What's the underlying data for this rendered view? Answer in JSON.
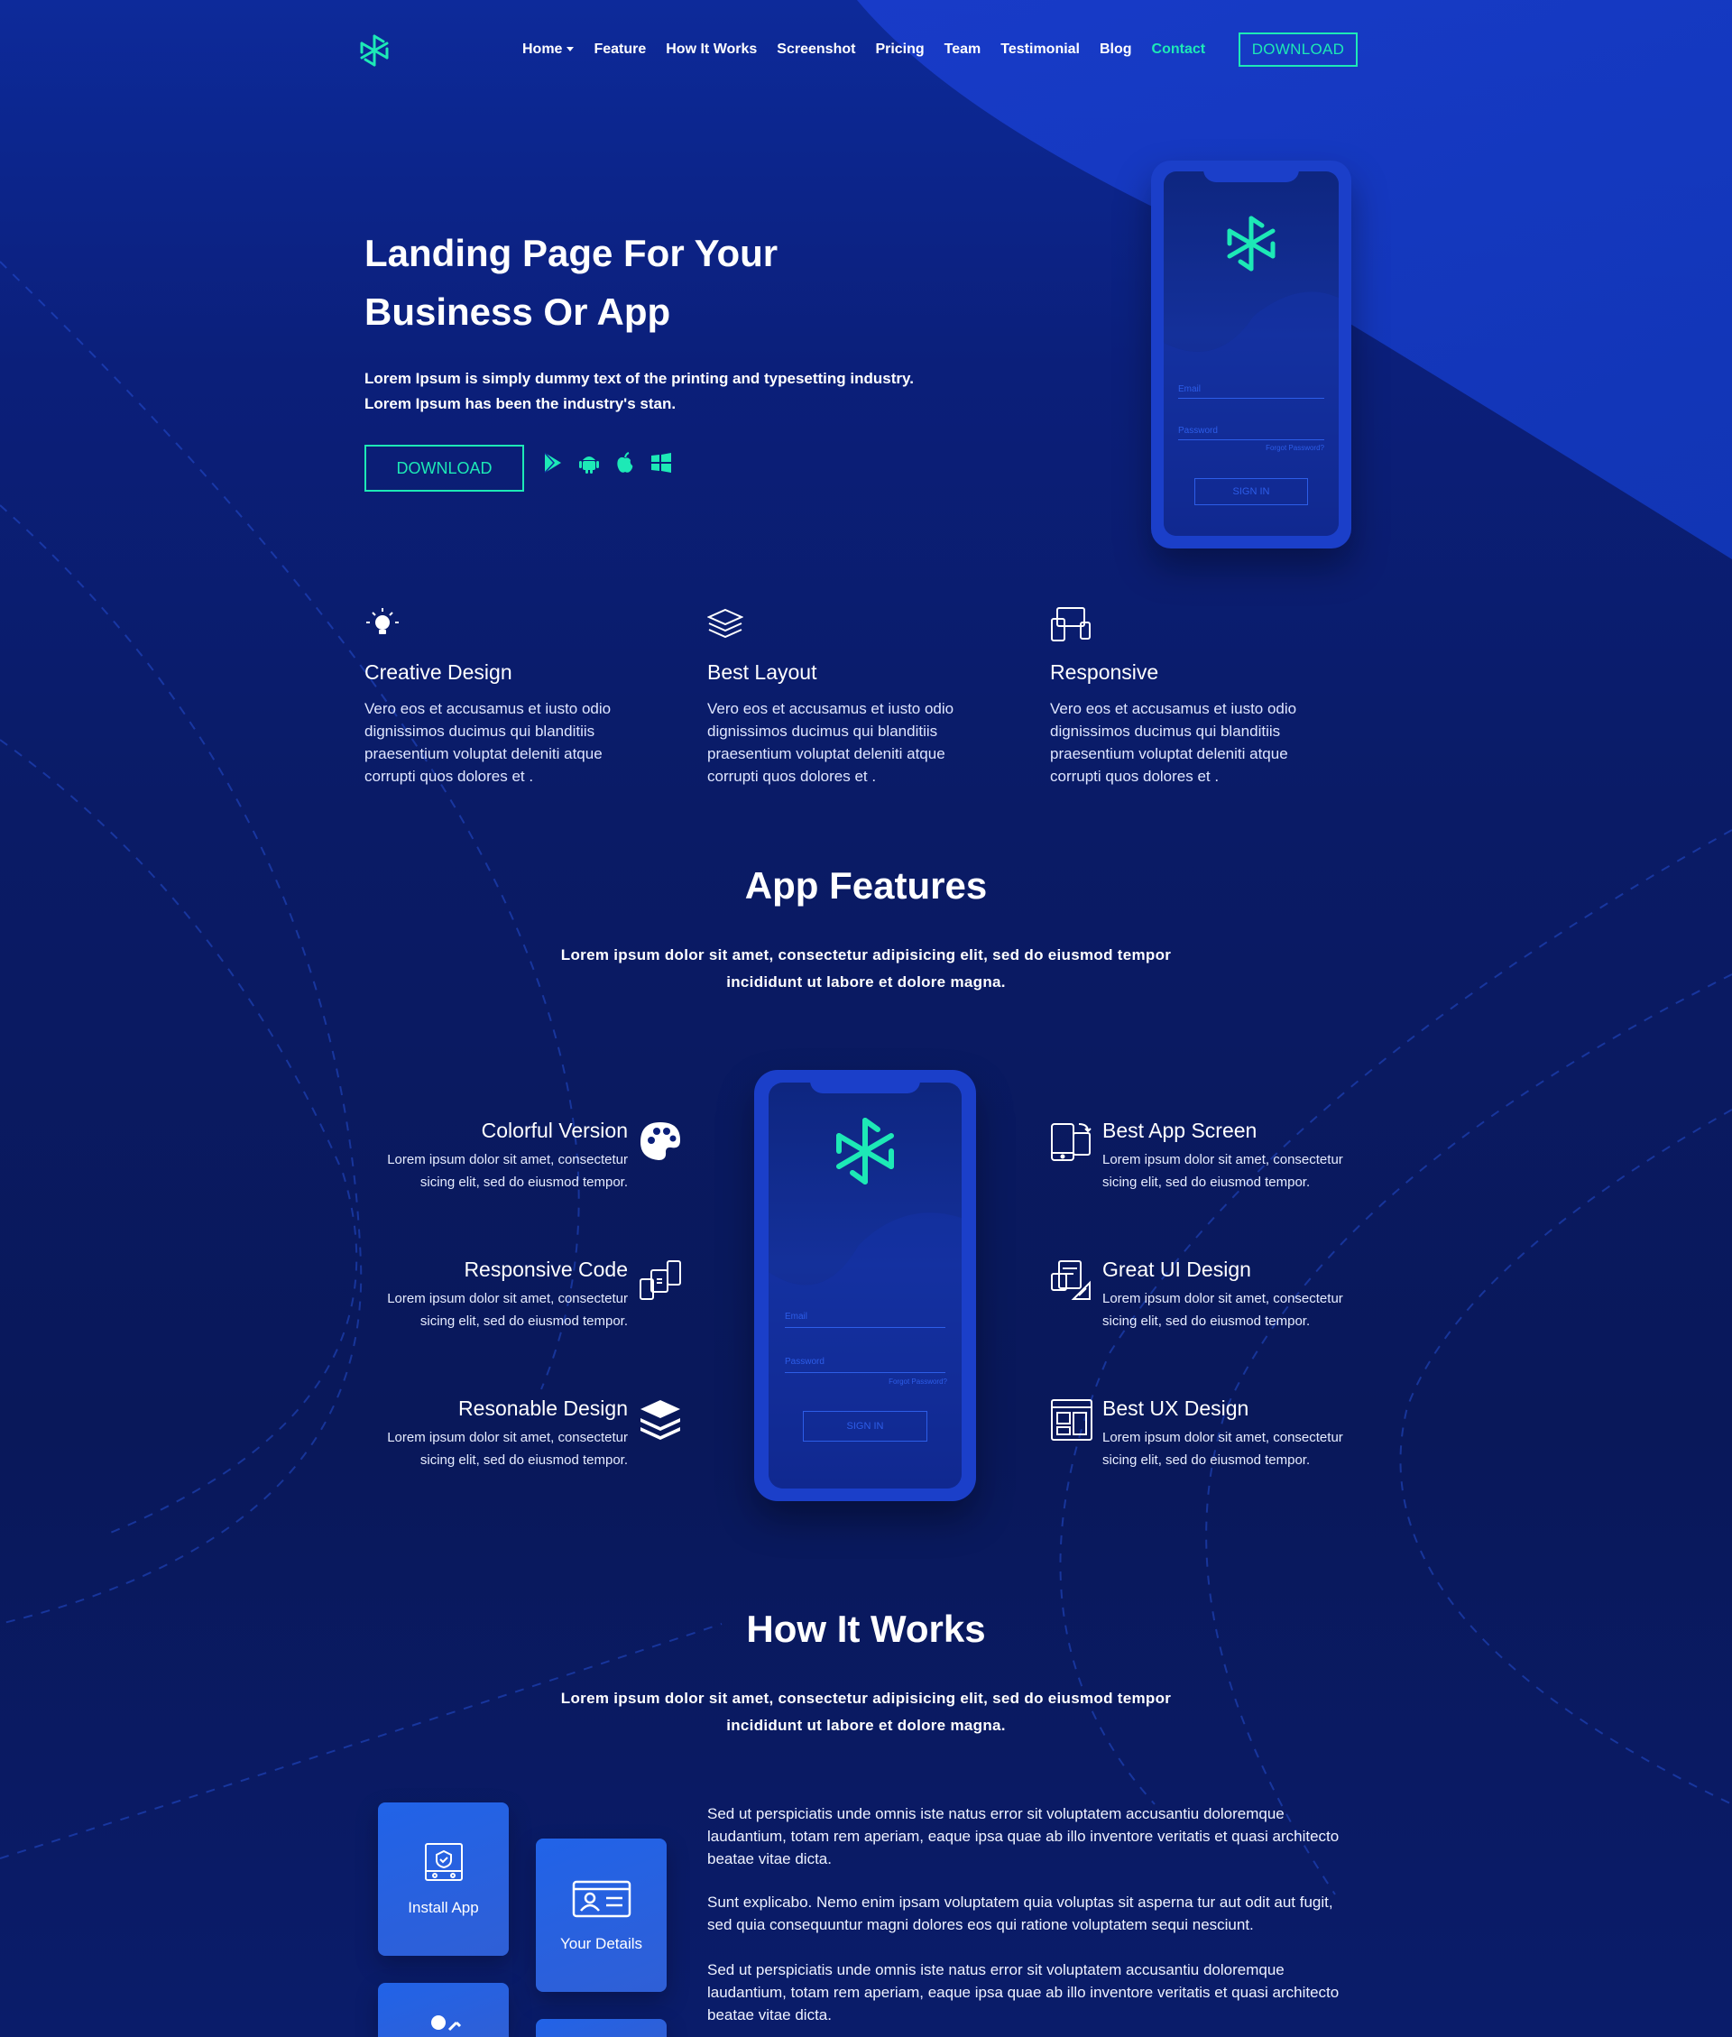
{
  "nav": {
    "items": [
      {
        "label": "Home",
        "active": false,
        "has_dropdown": true
      },
      {
        "label": "Feature",
        "active": false
      },
      {
        "label": "How It Works",
        "active": false
      },
      {
        "label": "Screenshot",
        "active": false
      },
      {
        "label": "Pricing",
        "active": false
      },
      {
        "label": "Team",
        "active": false
      },
      {
        "label": "Testimonial",
        "active": false
      },
      {
        "label": "Blog",
        "active": false
      },
      {
        "label": "Contact",
        "active": true
      }
    ],
    "download_label": "DOWNLOAD"
  },
  "hero": {
    "title_line1": "Landing Page For Your",
    "title_line2": "Business Or App",
    "text_line1": "Lorem Ipsum is simply dummy text of the printing and typesetting industry.",
    "text_line2": "Lorem Ipsum has been the industry's stan.",
    "download_label": "DOWNLOAD",
    "store_icons": [
      "google-play-icon",
      "android-icon",
      "apple-icon",
      "windows-icon"
    ]
  },
  "phone": {
    "email_label": "Email",
    "password_label": "Password",
    "forgot_label": "Forgot Password?",
    "signin_label": "SIGN IN"
  },
  "features": [
    {
      "icon": "lightbulb-icon",
      "title": "Creative Design",
      "text": "Vero eos et accusamus et iusto odio dignissimos ducimus qui blanditiis praesentium voluptat deleniti atque corrupti quos dolores et ."
    },
    {
      "icon": "layers-icon",
      "title": "Best Layout",
      "text": "Vero eos et accusamus et iusto odio dignissimos ducimus qui blanditiis praesentium voluptat deleniti atque corrupti quos dolores et ."
    },
    {
      "icon": "devices-icon",
      "title": "Responsive",
      "text": "Vero eos et accusamus et iusto odio dignissimos ducimus qui blanditiis praesentium voluptat deleniti atque corrupti quos dolores et ."
    }
  ],
  "app_features": {
    "title": "App Features",
    "subtitle_line1": "Lorem ipsum dolor sit amet, consectetur adipisicing elit, sed do eiusmod tempor",
    "subtitle_line2": "incididunt ut labore et dolore magna.",
    "left": [
      {
        "icon": "palette-icon",
        "title": "Colorful Version",
        "line1": "Lorem ipsum dolor sit amet, consectetur",
        "line2": "sicing elit, sed do eiusmod tempor."
      },
      {
        "icon": "responsive-code-icon",
        "title": "Responsive Code",
        "line1": "Lorem ipsum dolor sit amet, consectetur",
        "line2": "sicing elit, sed do eiusmod tempor."
      },
      {
        "icon": "stack-icon",
        "title": "Resonable Design",
        "line1": "Lorem ipsum dolor sit amet, consectetur",
        "line2": "sicing elit, sed do eiusmod tempor."
      }
    ],
    "right": [
      {
        "icon": "app-screen-icon",
        "title": "Best App Screen",
        "line1": "Lorem ipsum dolor sit amet, consectetur",
        "line2": "sicing elit, sed do eiusmod tempor."
      },
      {
        "icon": "ui-design-icon",
        "title": "Great UI Design",
        "line1": "Lorem ipsum dolor sit amet, consectetur",
        "line2": "sicing elit, sed do eiusmod tempor."
      },
      {
        "icon": "ux-design-icon",
        "title": "Best UX Design",
        "line1": "Lorem ipsum dolor sit amet, consectetur",
        "line2": "sicing elit, sed do eiusmod tempor."
      }
    ]
  },
  "how_it_works": {
    "title": "How It Works",
    "subtitle_line1": "Lorem ipsum dolor sit amet, consectetur adipisicing elit, sed do eiusmod tempor",
    "subtitle_line2": "incididunt ut labore et dolore magna.",
    "cards": [
      {
        "icon": "install-app-icon",
        "label": "Install App"
      },
      {
        "icon": "id-card-icon",
        "label": "Your Details"
      }
    ],
    "paragraphs": [
      "Sed ut perspiciatis unde omnis iste natus error sit voluptatem accusantiu doloremque laudantium, totam rem aperiam, eaque ipsa quae ab illo inventore veritatis et quasi architecto beatae vitae dicta.",
      "Sunt explicabo. Nemo enim ipsam voluptatem quia voluptas sit asperna tur aut odit aut fugit, sed quia consequuntur magni dolores eos qui ratione voluptatem sequi nesciunt.",
      "Sed ut perspiciatis unde omnis iste natus error sit voluptatem accusantiu doloremque laudantium, totam rem aperiam, eaque ipsa quae ab illo inventore veritatis et quasi architecto beatae vitae dicta."
    ]
  },
  "colors": {
    "accent": "#1de9b6",
    "bg_dark": "#0a1b66",
    "bg_light": "#1b3fc9",
    "card": "#2163e8"
  }
}
